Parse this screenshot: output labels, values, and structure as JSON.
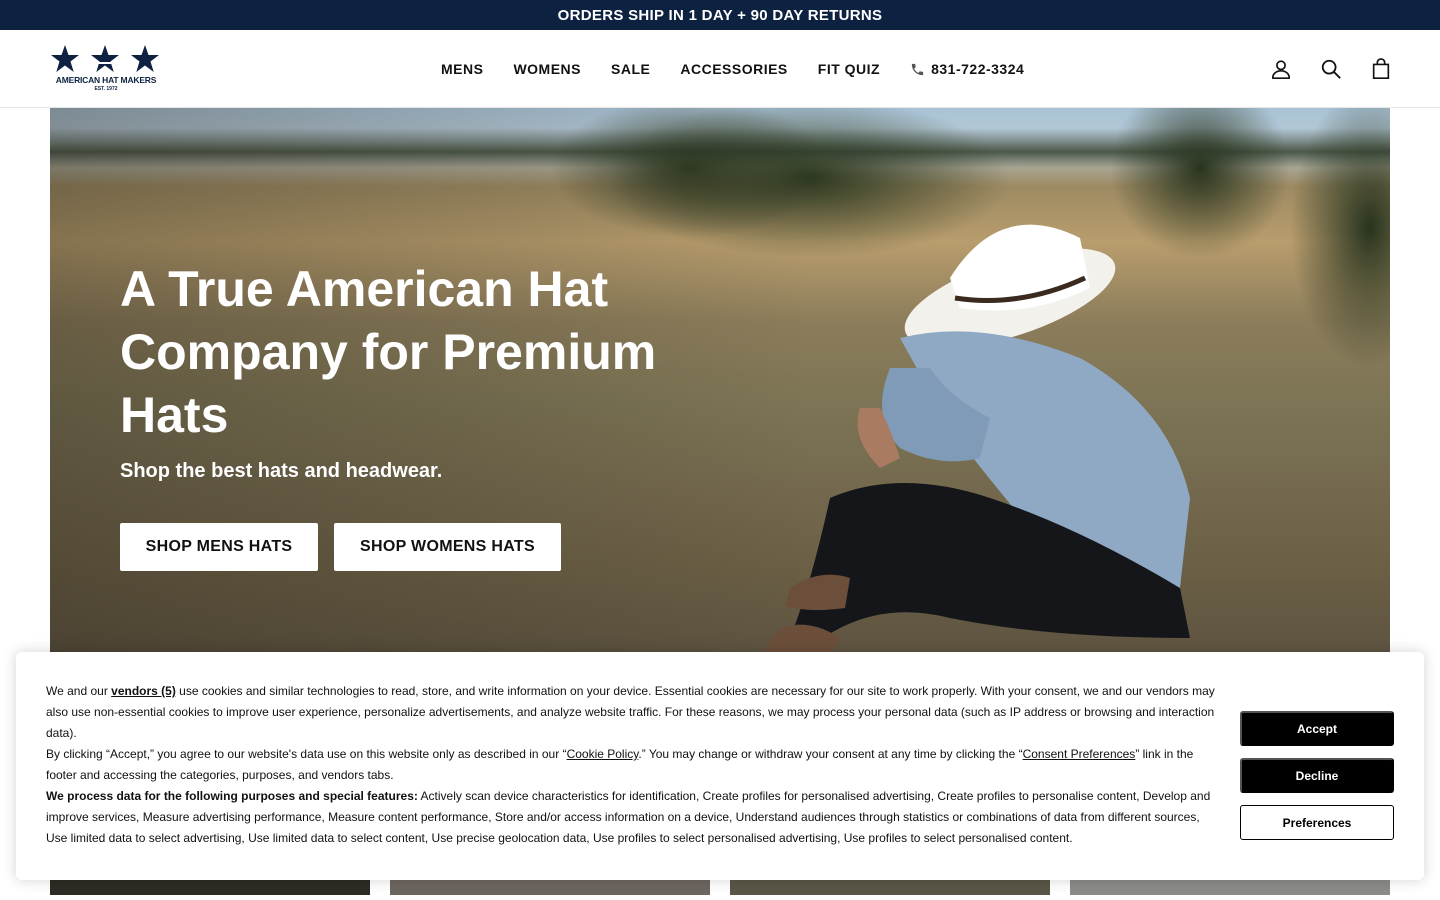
{
  "announcement": {
    "text": "ORDERS SHIP IN 1 DAY + 90 DAY RETURNS"
  },
  "header": {
    "logo": {
      "name": "AMERICAN HAT MAKERS",
      "est": "EST. 1972"
    },
    "nav": {
      "mens": "MENS",
      "womens": "WOMENS",
      "sale": "SALE",
      "accessories": "ACCESSORIES",
      "fit_quiz": "FIT QUIZ",
      "phone": "831-722-3324"
    },
    "icons": [
      "account-icon",
      "search-icon",
      "cart-icon"
    ]
  },
  "hero": {
    "title": "A True American Hat Company for Premium Hats",
    "subtitle": "Shop the best hats and headwear.",
    "button_mens": "SHOP MENS HATS",
    "button_womens": "SHOP WOMENS HATS"
  },
  "cookie": {
    "p1_start": "We and our ",
    "vendors_link": "vendors (5)",
    "p1_end": " use cookies and similar technologies to read, store, and write information on your device. Essential cookies are necessary for our site to work properly. With your consent, we and our vendors may also use non-essential cookies to improve user experience, personalize advertisements, and analyze website traffic. For these reasons, we may process your personal data (such as IP address or browsing and interaction data).",
    "p2_start": "By clicking “Accept,” you agree to our website's data use on this website only as described in our “",
    "cookie_policy_link": "Cookie Policy",
    "p2_mid": ".” You may change or withdraw your consent at any time by clicking the “",
    "consent_prefs_link": "Consent Preferences",
    "p2_end": "” link in the footer and accessing the categories, purposes, and vendors tabs.",
    "p3_bold": "We process data for the following purposes and special features:",
    "p3_rest": " Actively scan device characteristics for identification, Create profiles for personalised advertising, Create profiles to personalise content, Develop and improve services, Measure advertising performance, Measure content performance, Store and/or access information on a device, Understand audiences through statistics or combinations of data from different sources, Use limited data to select advertising, Use limited data to select content, Use precise geolocation data, Use profiles to select personalised advertising, Use profiles to select personalised content.",
    "accept": "Accept",
    "decline": "Decline",
    "preferences": "Preferences"
  },
  "colors": {
    "navy": "#0d2240",
    "button_dark": "#000000",
    "white": "#ffffff"
  }
}
